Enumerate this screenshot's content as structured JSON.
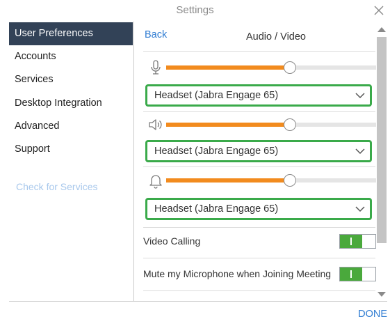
{
  "window": {
    "title": "Settings"
  },
  "sidebar": {
    "items": [
      {
        "label": "User Preferences",
        "active": true
      },
      {
        "label": "Accounts",
        "active": false
      },
      {
        "label": "Services",
        "active": false
      },
      {
        "label": "Desktop Integration",
        "active": false
      },
      {
        "label": "Advanced",
        "active": false
      },
      {
        "label": "Support",
        "active": false
      }
    ],
    "check_services_label": "Check for Services"
  },
  "content": {
    "back_label": "Back",
    "section_title": "Audio / Video",
    "microphone": {
      "icon": "microphone-icon",
      "level_percent": 59,
      "device": "Headset (Jabra Engage 65)"
    },
    "speaker": {
      "icon": "speaker-icon",
      "level_percent": 59,
      "device": "Headset (Jabra Engage 65)"
    },
    "ringer": {
      "icon": "bell-icon",
      "level_percent": 59,
      "device": "Headset (Jabra Engage 65)"
    },
    "video_calling": {
      "label": "Video Calling",
      "enabled": true
    },
    "mute_on_join": {
      "label": "Mute my Microphone when Joining Meeting",
      "enabled": true
    }
  },
  "footer": {
    "done_label": "DONE"
  },
  "colors": {
    "accent": "#2f7cd2",
    "sidebar_active": "#324257",
    "slider_fill": "#f28b1e",
    "select_border": "#3aaa4a",
    "toggle_on": "#4aa93c"
  }
}
